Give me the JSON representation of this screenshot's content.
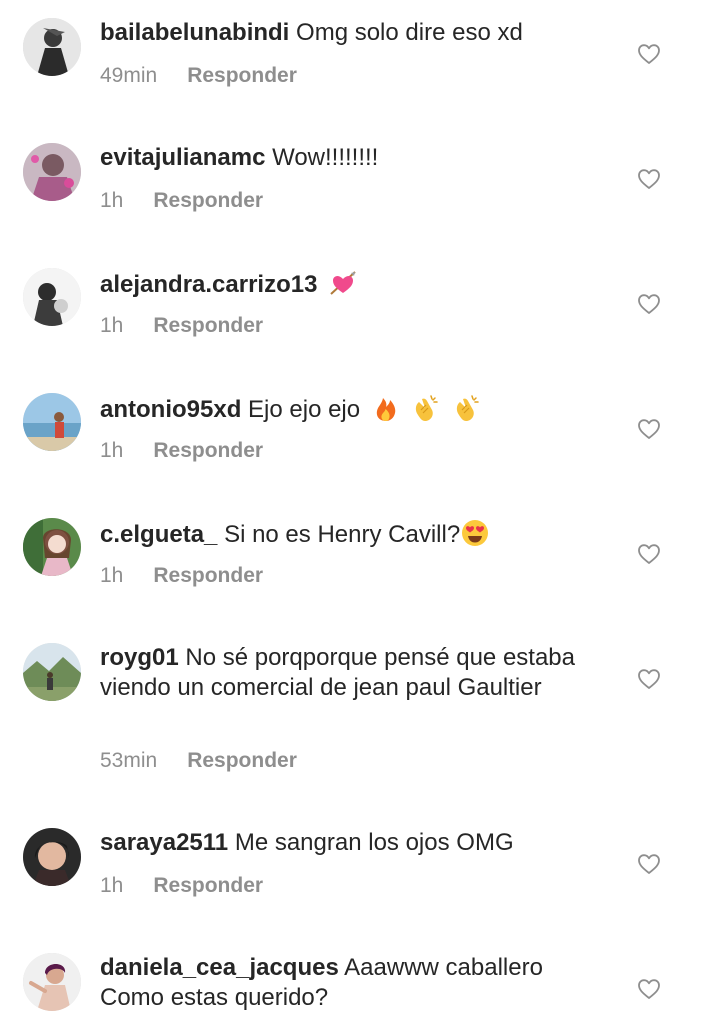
{
  "comments": [
    {
      "username": "bailabelunabindi",
      "text": "Omg solo dire eso xd",
      "time": "49min",
      "reply": "Responder"
    },
    {
      "username": "evitajulianamc",
      "text": "Wow!!!!!!!!",
      "time": "1h",
      "reply": "Responder"
    },
    {
      "username": "alejandra.carrizo13",
      "text": "",
      "emojis": [
        "heart-arrow-emoji"
      ],
      "time": "1h",
      "reply": "Responder"
    },
    {
      "username": "antonio95xd",
      "text": "Ejo ejo ejo",
      "emojis": [
        "fire-emoji",
        "clapping-hands-emoji",
        "clapping-hands-emoji"
      ],
      "time": "1h",
      "reply": "Responder"
    },
    {
      "username": "c.elgueta_",
      "text": "Si no es Henry Cavill?",
      "emojis": [
        "heart-eyes-emoji"
      ],
      "time": "1h",
      "reply": "Responder"
    },
    {
      "username": "royg01",
      "text": "No sé porqporque pensé que estaba viendo un comercial de jean paul Gaultier",
      "time": "53min",
      "reply": "Responder"
    },
    {
      "username": "saraya2511",
      "text": "Me sangran los ojos OMG",
      "time": "1h",
      "reply": "Responder"
    },
    {
      "username": "daniela_cea_jacques",
      "text": "Aaawww caballero Como estas querido?"
    }
  ],
  "icons": {
    "like": "heart-outline-icon"
  },
  "colors": {
    "text": "#262626",
    "secondary": "#8e8e8e"
  }
}
